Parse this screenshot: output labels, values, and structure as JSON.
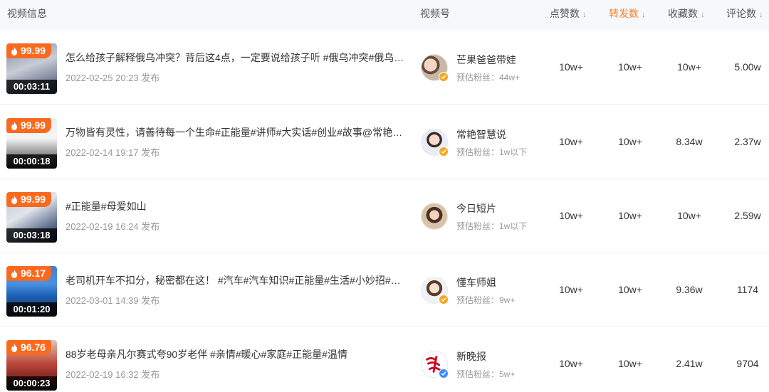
{
  "header": {
    "video_info": "视频信息",
    "channel": "视频号",
    "likes": "点赞数",
    "shares": "转发数",
    "favorites": "收藏数",
    "comments": "评论数",
    "sort_glyph": "↓"
  },
  "colors": {
    "accent": "#f7802b",
    "badge": "#f96a1f",
    "verified_gold": "#f5a623",
    "verified_blue": "#3d8ef7"
  },
  "rows": [
    {
      "score": "99.99",
      "duration": "00:03:11",
      "title": "怎么给孩子解释俄乌冲突？背后这4点，一定要说给孩子听 #俄乌冲突#俄乌局势#儿童教育",
      "date": "2022-02-25 20:23 发布",
      "channel_name": "芒果爸爸带娃",
      "fans": "预估粉丝：44w+",
      "likes": "10w+",
      "shares": "10w+",
      "favorites": "10w+",
      "comments": "5.00w"
    },
    {
      "score": "99.99",
      "duration": "00:00:18",
      "title": "万物皆有灵性，请善待每一个生命#正能量#讲师#大实话#创业#故事@常艳智慧说",
      "date": "2022-02-14 19:17 发布",
      "channel_name": "常艳智慧说",
      "fans": "预估粉丝：1w以下",
      "likes": "10w+",
      "shares": "10w+",
      "favorites": "8.34w",
      "comments": "2.37w"
    },
    {
      "score": "99.99",
      "duration": "00:03:18",
      "title": "#正能量#母爱如山",
      "date": "2022-02-19 16:24 发布",
      "channel_name": "今日短片",
      "fans": "预估粉丝：1w以下",
      "likes": "10w+",
      "shares": "10w+",
      "favorites": "10w+",
      "comments": "2.59w"
    },
    {
      "score": "96.17",
      "duration": "00:01:20",
      "title": "老司机开车不扣分，秘密都在这！ #汽车#汽车知识#正能量#生活#小妙招#驾驶技巧",
      "date": "2022-03-01 14:39 发布",
      "channel_name": "懂车师姐",
      "fans": "预估粉丝：9w+",
      "likes": "10w+",
      "shares": "10w+",
      "favorites": "9.36w",
      "comments": "1174"
    },
    {
      "score": "96.76",
      "duration": "00:00:23",
      "title": "88岁老母亲凡尔赛式夸90岁老伴 #亲情#暖心#家庭#正能量#温情",
      "date": "2022-02-19 16:32 发布",
      "channel_name": "新晚报",
      "fans": "预估粉丝：5w+",
      "likes": "10w+",
      "shares": "10w+",
      "favorites": "2.41w",
      "comments": "9704"
    }
  ]
}
